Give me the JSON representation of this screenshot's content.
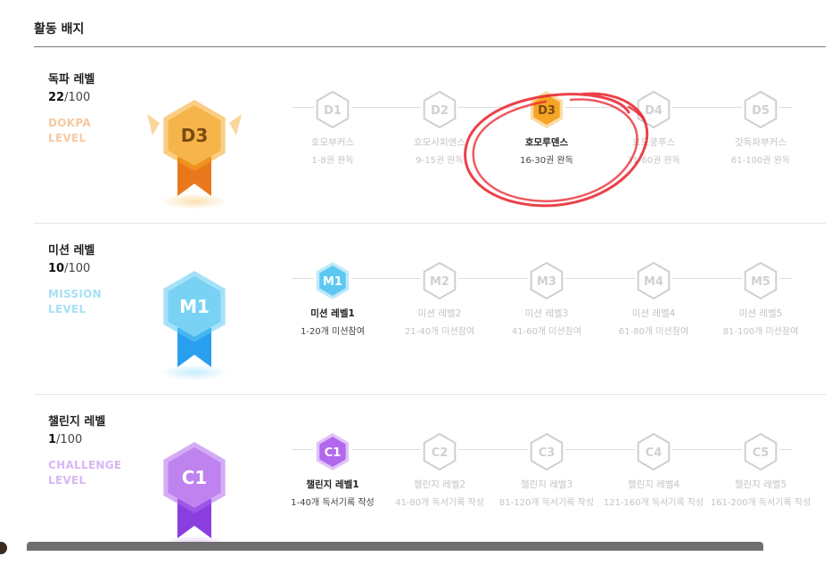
{
  "page_title": "활동 배지",
  "sections": [
    {
      "id": "dokpa",
      "name": "독파 레벨",
      "progress_current": "22",
      "progress_total": "/100",
      "en_line1": "DOKPA",
      "en_line2": "LEVEL",
      "big_badge_label": "D3",
      "accent": "#f5a523",
      "accent_dark": "#e9781c",
      "en_color": "#f6c9a0",
      "active_index": 2,
      "levels": [
        {
          "code": "D1",
          "name": "호모부커스",
          "range": "1-8권 완독"
        },
        {
          "code": "D2",
          "name": "호모사피엔스",
          "range": "9-15권 완독"
        },
        {
          "code": "D3",
          "name": "호모루덴스",
          "range": "16-30권 완독"
        },
        {
          "code": "D4",
          "name": "호모쿵푸스",
          "range": "31-60권 완독"
        },
        {
          "code": "D5",
          "name": "갓독파부커스",
          "range": "61-100권 완독"
        }
      ]
    },
    {
      "id": "mission",
      "name": "미션 레벨",
      "progress_current": "10",
      "progress_total": "/100",
      "en_line1": "MISSION",
      "en_line2": "LEVEL",
      "big_badge_label": "M1",
      "accent": "#5cc8f2",
      "accent_dark": "#2a9ff0",
      "en_color": "#a8e0f6",
      "active_index": 0,
      "levels": [
        {
          "code": "M1",
          "name": "미션 레벨1",
          "range": "1-20개 미션참여"
        },
        {
          "code": "M2",
          "name": "미션 레벨2",
          "range": "21-40개 미션참여"
        },
        {
          "code": "M3",
          "name": "미션 레벨3",
          "range": "41-60개 미션참여"
        },
        {
          "code": "M4",
          "name": "미션 레벨4",
          "range": "61-80개 미션참여"
        },
        {
          "code": "M5",
          "name": "미션 레벨5",
          "range": "81-100개 미션참여"
        }
      ]
    },
    {
      "id": "challenge",
      "name": "챌린지 레벨",
      "progress_current": "1",
      "progress_total": "/100",
      "en_line1": "CHALLENGE",
      "en_line2": "LEVEL",
      "big_badge_label": "C1",
      "accent": "#b168ec",
      "accent_dark": "#8a3ee0",
      "en_color": "#d8b6f4",
      "active_index": 0,
      "levels": [
        {
          "code": "C1",
          "name": "챌린지 레벨1",
          "range": "1-40개 독서기록 작성"
        },
        {
          "code": "C2",
          "name": "챌린지 레벨2",
          "range": "41-80개 독서기록 작성"
        },
        {
          "code": "C3",
          "name": "챌린지 레벨3",
          "range": "81-120개 독서기록 작성"
        },
        {
          "code": "C4",
          "name": "챌린지 레벨4",
          "range": "121-160개 독서기록 작성"
        },
        {
          "code": "C5",
          "name": "챌린지 레벨5",
          "range": "161-200개 독서기록 작성"
        }
      ]
    }
  ],
  "annotation_color": "#e8202a",
  "inactive_color": "#cfcfcf"
}
